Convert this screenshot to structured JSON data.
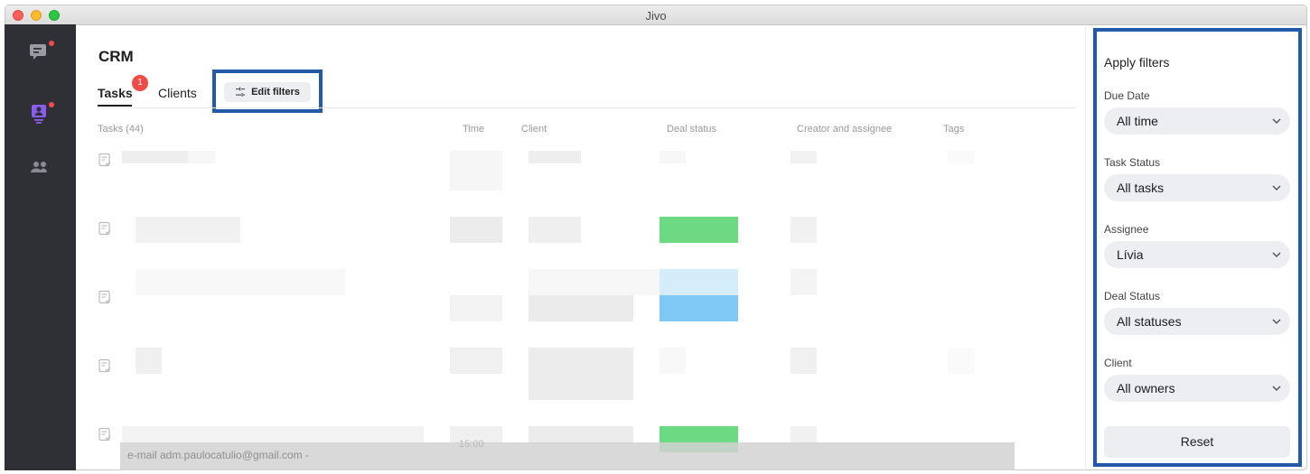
{
  "window": {
    "title": "Jivo"
  },
  "sidebar": {
    "items": [
      {
        "icon": "chat-icon",
        "has_dot": true
      },
      {
        "icon": "crm-contact-icon",
        "has_dot": true,
        "active": true
      },
      {
        "icon": "team-icon",
        "has_dot": false
      }
    ],
    "accent_color": "#8a5cf0",
    "dot_color": "#f04d4d"
  },
  "header": {
    "title": "CRM",
    "tabs": [
      {
        "label": "Tasks",
        "badge": "1",
        "active": true
      },
      {
        "label": "Clients",
        "active": false
      }
    ],
    "edit_filters_label": "Edit filters"
  },
  "table": {
    "columns": [
      "Tasks (44)",
      "Time",
      "Client",
      "Deal status",
      "Creator and assignee",
      "Tags"
    ]
  },
  "toast": {
    "text": "e-mail adm.paulocatulio@gmail.com -",
    "time": "15:00"
  },
  "filters": {
    "title": "Apply filters",
    "groups": [
      {
        "label": "Due Date",
        "value": "All time"
      },
      {
        "label": "Task Status",
        "value": "All tasks"
      },
      {
        "label": "Assignee",
        "value": "Lívia"
      },
      {
        "label": "Deal Status",
        "value": "All statuses"
      },
      {
        "label": "Client",
        "value": "All owners"
      }
    ],
    "reset_label": "Reset"
  },
  "colors": {
    "highlight_border": "#2259a8",
    "badge": "#ef4b47",
    "deal_green": "#6dd982",
    "deal_blue": "#80c9f7"
  }
}
